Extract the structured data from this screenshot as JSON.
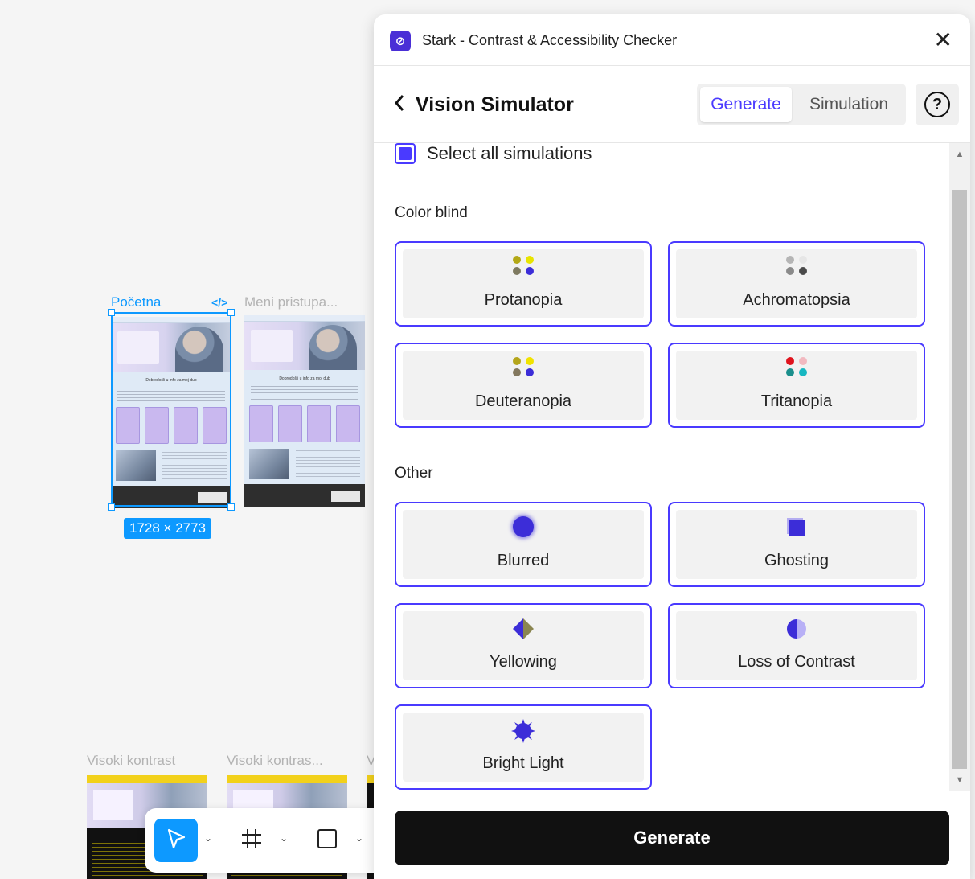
{
  "canvas": {
    "frames": [
      {
        "label": "Početna",
        "selected": true
      },
      {
        "label": "Meni pristupa..."
      },
      {
        "label": "Visoki kontrast"
      },
      {
        "label": "Visoki kontras..."
      },
      {
        "label": "V"
      }
    ],
    "thumb_title": "Dobrodošli u info za moj dub",
    "selection_dims": "1728 × 2773",
    "code_icon": "</>"
  },
  "toolbar": {
    "tools": [
      {
        "name": "move-tool",
        "icon": "cursor-arrow-icon",
        "active": true
      },
      {
        "name": "frame-tool",
        "icon": "hash-frame-icon"
      },
      {
        "name": "shape-tool",
        "icon": "square-icon"
      }
    ]
  },
  "plugin": {
    "title": "Stark - Contrast & Accessibility Checker",
    "close": "✕",
    "header": {
      "back": "‹",
      "title": "Vision Simulator",
      "tabs": [
        "Generate",
        "Simulation"
      ],
      "active_tab": "Generate",
      "help": "?"
    },
    "select_all": {
      "label": "Select all simulations",
      "checked": true
    },
    "sections": [
      {
        "title": "Color blind",
        "items": [
          "Protanopia",
          "Achromatopsia",
          "Deuteranopia",
          "Tritanopia"
        ]
      },
      {
        "title": "Other",
        "items": [
          "Blurred",
          "Ghosting",
          "Yellowing",
          "Loss of Contrast",
          "Bright Light"
        ]
      }
    ],
    "generate_label": "Generate",
    "colors": {
      "accent": "#4a3aff",
      "logo": "#4a2fd6",
      "figma_blue": "#0d99ff"
    }
  }
}
